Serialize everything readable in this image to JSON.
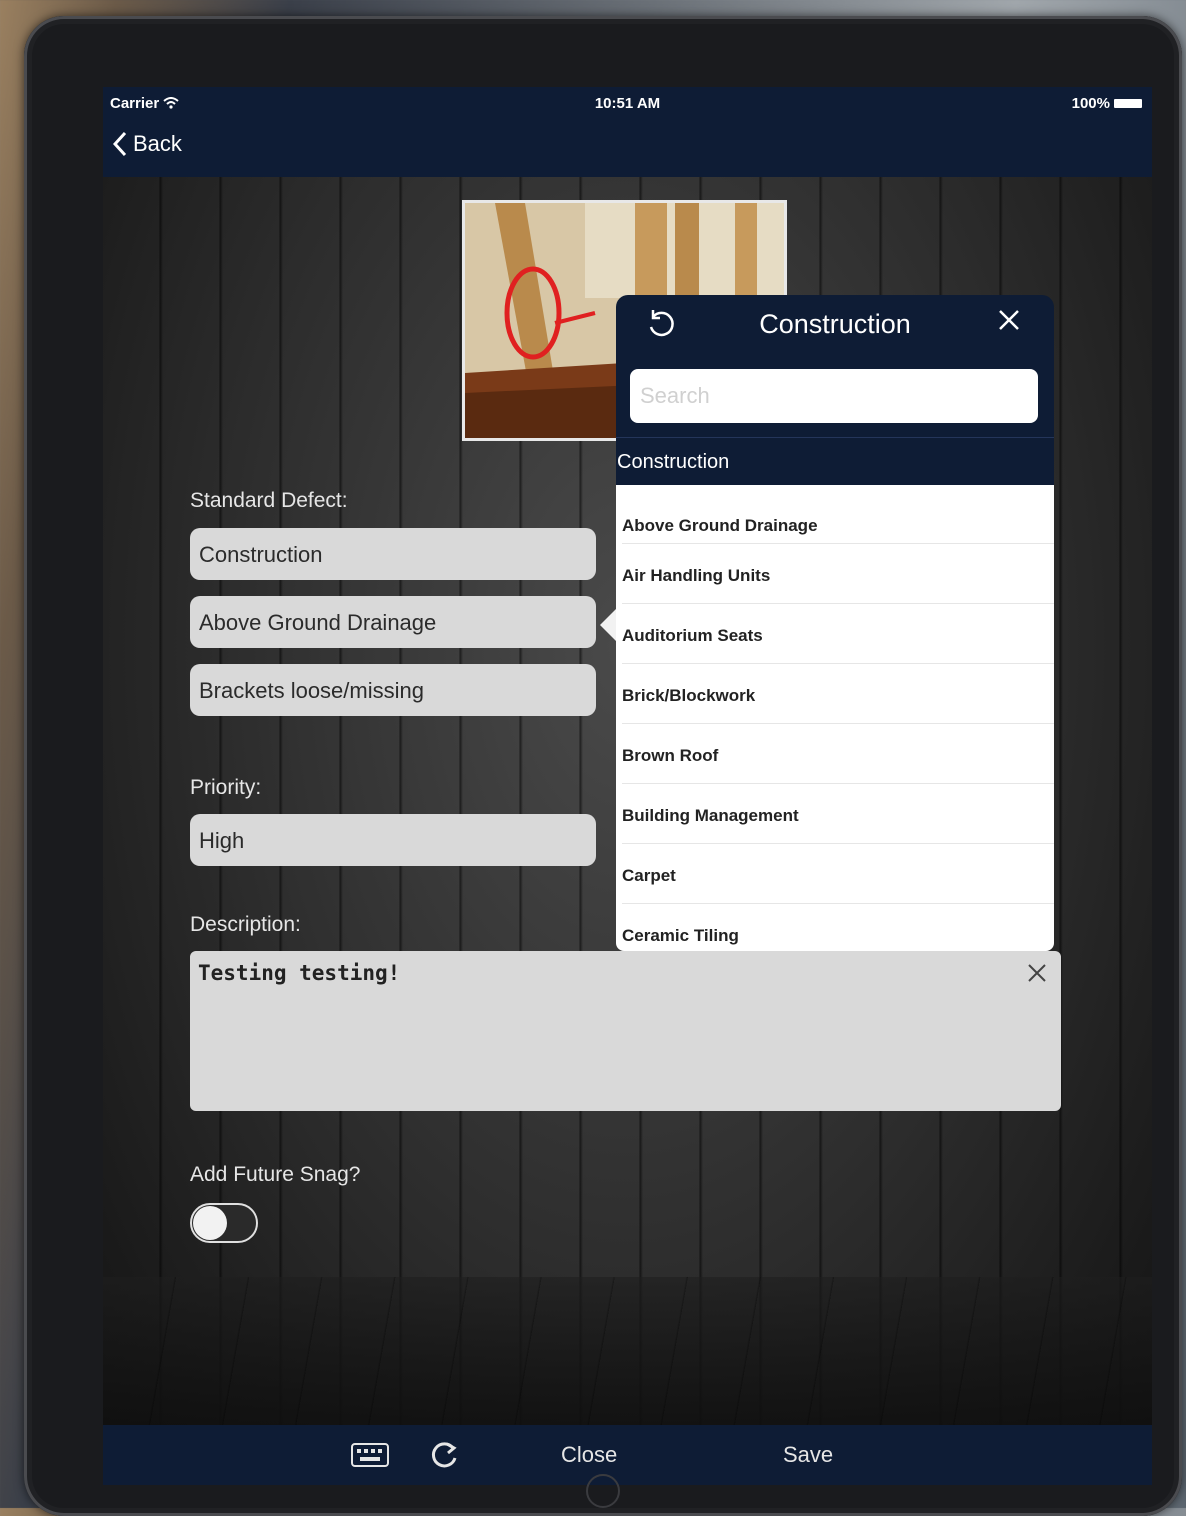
{
  "status_bar": {
    "carrier": "Carrier",
    "time": "10:51 AM",
    "battery": "100%"
  },
  "nav": {
    "back_label": "Back"
  },
  "form": {
    "standard_defect_label": "Standard Defect:",
    "defect_category": "Construction",
    "defect_subcategory": "Above Ground Drainage",
    "defect_detail": "Brackets loose/missing",
    "priority_label": "Priority:",
    "priority_value": "High",
    "description_label": "Description:",
    "description_value": "Testing testing!",
    "future_snag_label": "Add Future Snag?",
    "future_snag_on": false
  },
  "popover": {
    "title": "Construction",
    "search_placeholder": "Search",
    "section_header": "Construction",
    "items": [
      "Above Ground Drainage",
      "Air Handling Units",
      "Auditorium Seats",
      "Brick/Blockwork",
      "Brown Roof",
      "Building Management",
      "Carpet",
      "Ceramic Tiling"
    ]
  },
  "toolbar": {
    "close_label": "Close",
    "save_label": "Save"
  },
  "colors": {
    "navbar": "#0e1c35",
    "field_bg": "#d9d9d9",
    "annotation": "#e02020"
  }
}
